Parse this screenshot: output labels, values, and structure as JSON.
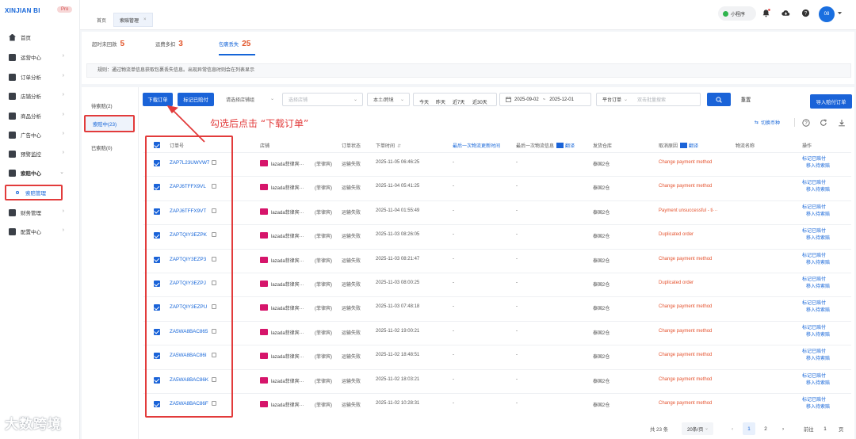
{
  "brand": {
    "logo": "XINJIAN BI",
    "badge": "Pro"
  },
  "sidebar": {
    "items": [
      {
        "label": "首页",
        "icon": "home-icon"
      },
      {
        "label": "运营中心",
        "icon": "monitor-icon"
      },
      {
        "label": "订单分析",
        "icon": "bar-chart-icon"
      },
      {
        "label": "店铺分析",
        "icon": "store-icon"
      },
      {
        "label": "商品分析",
        "icon": "bag-icon"
      },
      {
        "label": "广告中心",
        "icon": "ad-icon"
      },
      {
        "label": "预警监控",
        "icon": "alert-icon"
      },
      {
        "label": "索赔中心",
        "icon": "claim-icon"
      },
      {
        "label": "财务管理",
        "icon": "finance-icon"
      },
      {
        "label": "配置中心",
        "icon": "settings-icon"
      }
    ],
    "sub_item": "索赔管理"
  },
  "tabs": [
    "首页",
    "索赔管理"
  ],
  "topbar": {
    "mini_program": "小程序",
    "avatar": "08"
  },
  "stats": [
    {
      "label": "超时未回款",
      "value": "5"
    },
    {
      "label": "运费多扣",
      "value": "3"
    },
    {
      "label": "包裹丢失",
      "value": "25"
    }
  ],
  "rule": "规则：通过物流单信息获取包裹丢失信息。出现异常信息时则会在列表显示",
  "left_tabs": [
    "待索赔(2)",
    "索赔中(23)",
    "已索赔(0)"
  ],
  "toolbar": {
    "download": "下载订单",
    "mark_paid": "标记已赔付",
    "shop_select": "请选择店铺组",
    "store_select": "选择店铺",
    "site_select": "本土/跨境",
    "quick_dates": [
      "今天",
      "昨天",
      "近7天",
      "近30天"
    ],
    "date_start": "2025-09-02",
    "date_sep": "~",
    "date_end": "2025-12-01",
    "order_type": "平台订单",
    "search_placeholder": "双击批量搜索",
    "reset": "重置",
    "import": "导入赔付订单",
    "switch_currency": "切换币种"
  },
  "annotation": "勾选后点击 “下载订单”",
  "columns": [
    "订单号",
    "店铺",
    "订单状态",
    "下单时间",
    "最后一次物流更新时间",
    "最后一次物流信息",
    "翻译",
    "发货仓库",
    "取消原因",
    "翻译",
    "物流名称",
    "操作"
  ],
  "rows": [
    {
      "id": "ZAP7L23UWVW7",
      "shop": "lazada菲律宾···",
      "region": "(菲律宾)",
      "status": "运输失败",
      "time": "2025-11-05 06:46:25",
      "upd": "-",
      "info": "-",
      "wh": "泰国2仓",
      "reason": "Change payment method"
    },
    {
      "id": "ZAPJ6TFFX9VL",
      "shop": "lazada菲律宾···",
      "region": "(菲律宾)",
      "status": "运输失败",
      "time": "2025-11-04 05:41:25",
      "upd": "-",
      "info": "-",
      "wh": "泰国2仓",
      "reason": "Change payment method"
    },
    {
      "id": "ZAPJ6TFFX9VT",
      "shop": "lazada菲律宾···",
      "region": "(菲律宾)",
      "status": "运输失败",
      "time": "2025-11-04 01:55:49",
      "upd": "-",
      "info": "-",
      "wh": "泰国2仓",
      "reason": "Payment unsuccessful - ti···"
    },
    {
      "id": "ZAPTQIY3EZPK",
      "shop": "lazada菲律宾···",
      "region": "(菲律宾)",
      "status": "运输失败",
      "time": "2025-11-03 08:26:05",
      "upd": "-",
      "info": "-",
      "wh": "泰国2仓",
      "reason": "Duplicated order"
    },
    {
      "id": "ZAPTQIY3EZP3",
      "shop": "lazada菲律宾···",
      "region": "(菲律宾)",
      "status": "运输失败",
      "time": "2025-11-03 08:21:47",
      "upd": "-",
      "info": "-",
      "wh": "泰国2仓",
      "reason": "Change payment method"
    },
    {
      "id": "ZAPTQIY3EZPJ",
      "shop": "lazada菲律宾···",
      "region": "(菲律宾)",
      "status": "运输失败",
      "time": "2025-11-03 08:00:25",
      "upd": "-",
      "info": "-",
      "wh": "泰国2仓",
      "reason": "Duplicated order"
    },
    {
      "id": "ZAPTQIY3EZPU",
      "shop": "lazada菲律宾···",
      "region": "(菲律宾)",
      "status": "运输失败",
      "time": "2025-11-03 07:48:18",
      "upd": "-",
      "info": "-",
      "wh": "泰国2仓",
      "reason": "Change payment method"
    },
    {
      "id": "ZA5WA8BAC865",
      "shop": "lazada菲律宾···",
      "region": "(菲律宾)",
      "status": "运输失败",
      "time": "2025-11-02 19:00:21",
      "upd": "-",
      "info": "-",
      "wh": "泰国2仓",
      "reason": "Change payment method"
    },
    {
      "id": "ZA5WA8BAC86I",
      "shop": "lazada菲律宾···",
      "region": "(菲律宾)",
      "status": "运输失败",
      "time": "2025-11-02 18:48:51",
      "upd": "-",
      "info": "-",
      "wh": "泰国2仓",
      "reason": "Change payment method"
    },
    {
      "id": "ZA5WA8BAC86K",
      "shop": "lazada菲律宾···",
      "region": "(菲律宾)",
      "status": "运输失败",
      "time": "2025-11-02 18:03:21",
      "upd": "-",
      "info": "-",
      "wh": "泰国2仓",
      "reason": "Change payment method"
    },
    {
      "id": "ZA5WA8BAC86F",
      "shop": "lazada菲律宾···",
      "region": "(菲律宾)",
      "status": "运输失败",
      "time": "2025-11-02 10:28:31",
      "upd": "-",
      "info": "-",
      "wh": "泰国2仓",
      "reason": "Change payment method"
    }
  ],
  "row_actions": [
    "标记已赔付",
    "移入待索赔"
  ],
  "pagination": {
    "total": "共 23 条",
    "page_size": "20条/页",
    "pages": [
      "1",
      "2"
    ],
    "goto_label": "前往",
    "goto_value": "1",
    "goto_suffix": "页"
  },
  "watermark": "大数跨境"
}
